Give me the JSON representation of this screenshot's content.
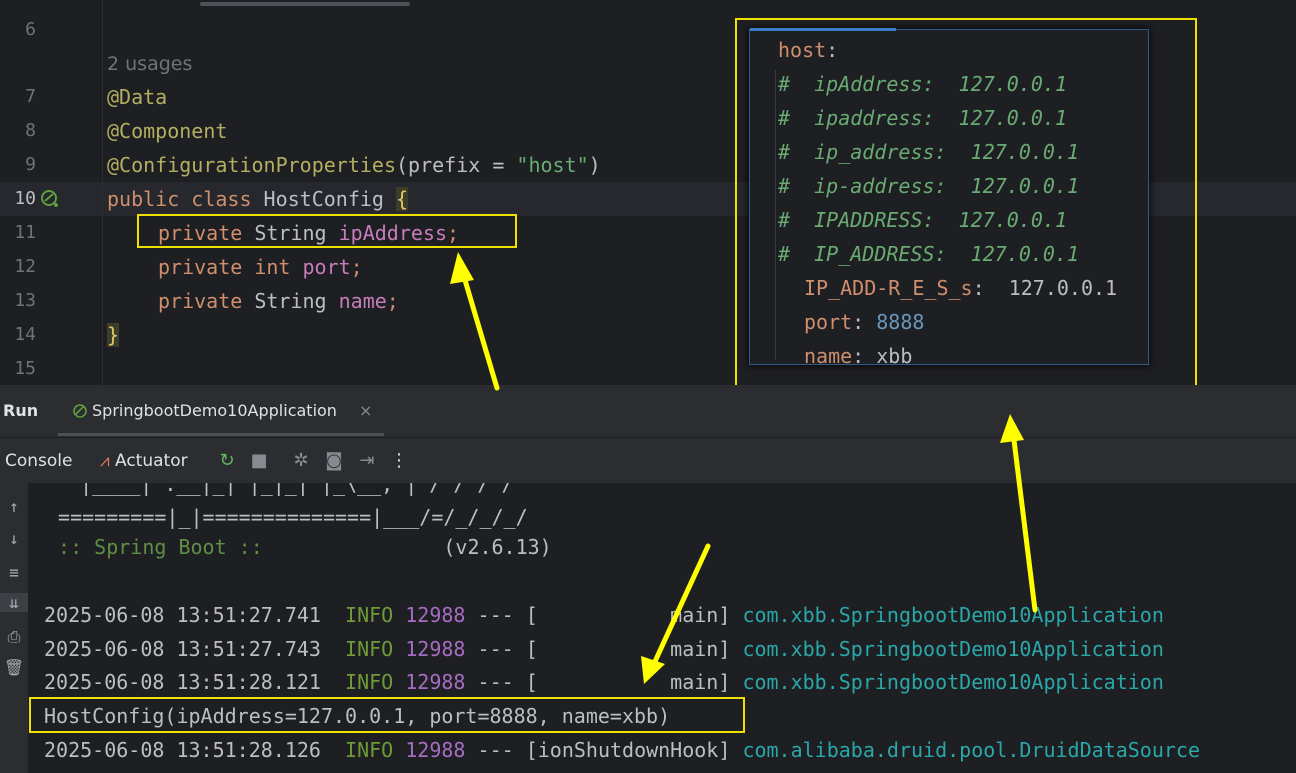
{
  "editor": {
    "usages_hint": "2 usages",
    "lines": [
      {
        "no": "6",
        "text": ""
      },
      {
        "no": "7",
        "text": "@Data"
      },
      {
        "no": "8",
        "text": "@Component"
      },
      {
        "no": "9",
        "prefix_ann": "@ConfigurationProperties",
        "open": "(prefix = ",
        "str": "\"host\"",
        "close": ")"
      },
      {
        "no": "10",
        "kw": "public class ",
        "name": "HostConfig ",
        "brace": "{"
      },
      {
        "no": "11",
        "kw": "private ",
        "type": "String ",
        "field": "ipAddress",
        "end": ";"
      },
      {
        "no": "12",
        "kw": "private ",
        "type": "int ",
        "field": "port",
        "end": ";"
      },
      {
        "no": "13",
        "kw": "private ",
        "type": "String ",
        "field": "name",
        "end": ";"
      },
      {
        "no": "14",
        "brace": "}"
      },
      {
        "no": "15",
        "text": ""
      }
    ]
  },
  "yaml": {
    "root_key": "host",
    "comments": [
      "#  ipAddress:  127.0.0.1",
      "#  ipaddress:  127.0.0.1",
      "#  ip_address:  127.0.0.1",
      "#  ip-address:  127.0.0.1",
      "#  IPADDRESS:  127.0.0.1",
      "#  IP_ADDRESS:  127.0.0.1"
    ],
    "entries": [
      {
        "key": "IP_ADD-R_E_S_s",
        "value": "127.0.0.1"
      },
      {
        "key": "port",
        "value": "8888"
      },
      {
        "key": "name",
        "value": "xbb"
      }
    ]
  },
  "run": {
    "title": "Run",
    "tab_label": "SpringbootDemo10Application",
    "console_tab": "Console",
    "actuator_tab": "Actuator"
  },
  "console": {
    "banner_top": "  |____| .__|_| |_|_| |_\\__, | / / / /",
    "banner_line": " =========|_|==============|___/=/_/_/_/",
    "banner_spring": " :: Spring Boot :: ",
    "banner_version": "              (v2.6.13)",
    "logs": [
      {
        "ts": "2025-06-08 13:51:27.741",
        "level": "INFO",
        "pid": "12988",
        "sep": " --- [",
        "thread": "           main] ",
        "logger": "com.xbb.SpringbootDemo10Application"
      },
      {
        "ts": "2025-06-08 13:51:27.743",
        "level": "INFO",
        "pid": "12988",
        "sep": " --- [",
        "thread": "           main] ",
        "logger": "com.xbb.SpringbootDemo10Application"
      },
      {
        "ts": "2025-06-08 13:51:28.121",
        "level": "INFO",
        "pid": "12988",
        "sep": " --- [",
        "thread": "           main] ",
        "logger": "com.xbb.SpringbootDemo10Application"
      }
    ],
    "output": "HostConfig(ipAddress=127.0.0.1, port=8888, name=xbb)",
    "last_log": {
      "ts": "2025-06-08 13:51:28.126",
      "level": "INFO",
      "pid": "12988",
      "sep": " --- [",
      "thread": "ionShutdownHook] ",
      "logger": "com.alibaba.druid.pool.DruidDataSource"
    }
  },
  "colors": {
    "highlight": "#f0e000",
    "arrow": "#ffff00"
  }
}
